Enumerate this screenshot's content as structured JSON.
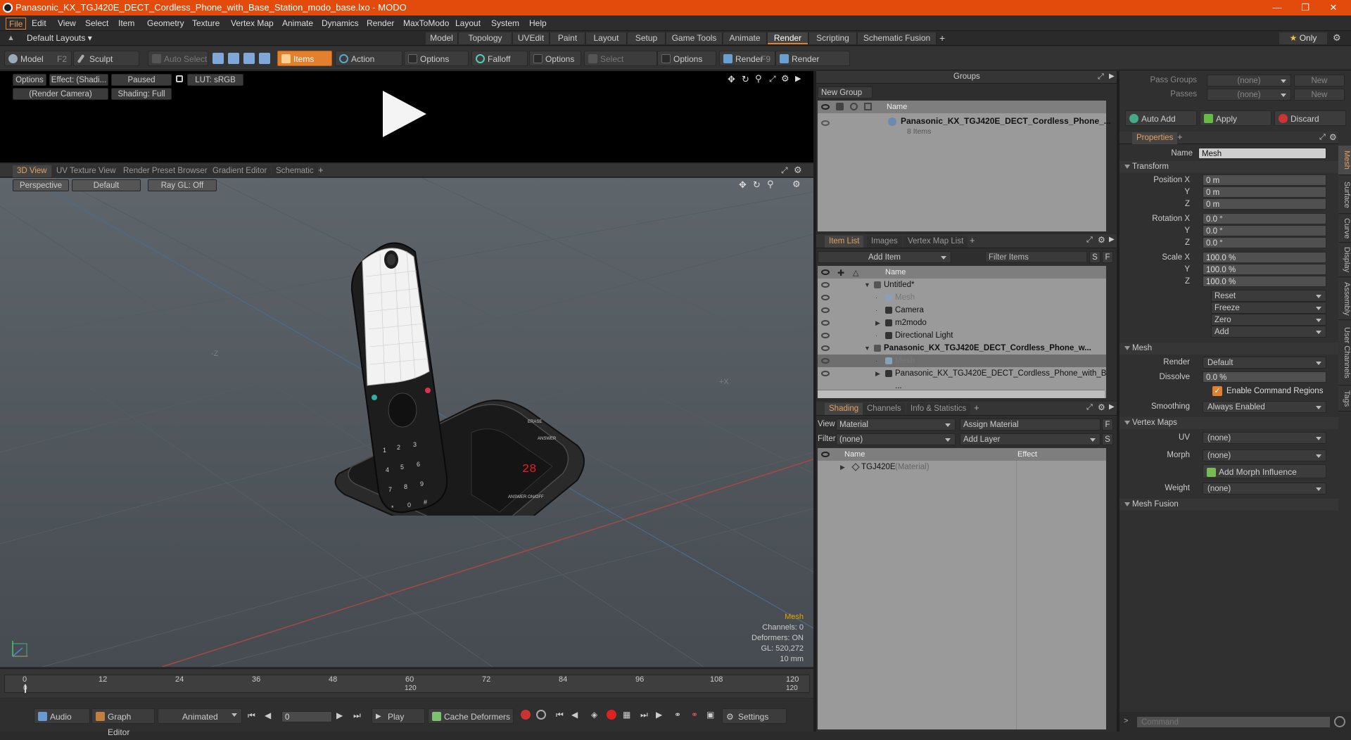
{
  "window": {
    "title": "Panasonic_KX_TGJ420E_DECT_Cordless_Phone_with_Base_Station_modo_base.lxo - MODO"
  },
  "menu": [
    "File",
    "Edit",
    "View",
    "Select",
    "Item",
    "Geometry",
    "Texture",
    "Vertex Map",
    "Animate",
    "Dynamics",
    "Render",
    "MaxToModo",
    "Layout",
    "System",
    "Help"
  ],
  "layout": {
    "default_layouts": "Default Layouts",
    "tabs": [
      "Model",
      "Topology",
      "UVEdit",
      "Paint",
      "Layout",
      "Setup",
      "Game Tools",
      "Animate",
      "Render",
      "Scripting",
      "Schematic Fusion"
    ],
    "active_tab": "Render",
    "only_label": "Only"
  },
  "toolbar": {
    "model": "Model",
    "model_key": "F2",
    "sculpt": "Sculpt",
    "auto_select": "Auto Select",
    "items": "Items",
    "action_center": "Action Center",
    "options1": "Options",
    "falloff": "Falloff",
    "options2": "Options",
    "select_through": "Select Through",
    "options3": "Options",
    "render": "Render",
    "render_key": "F9",
    "render_window": "Render Window"
  },
  "render_view": {
    "options": "Options",
    "effect": "Effect: (Shadi...",
    "paused": "Paused",
    "lut": "LUT: sRGB",
    "camera": "(Render Camera)",
    "shading": "Shading: Full"
  },
  "viewport": {
    "tabs": [
      "3D View",
      "UV Texture View",
      "Render Preset Browser",
      "Gradient Editor",
      "Schematic"
    ],
    "perspective": "Perspective",
    "default": "Default",
    "raygl": "Ray GL: Off",
    "axis_z": "-Z",
    "axis_x": "+X",
    "info": {
      "title": "Mesh",
      "channels": "Channels: 0",
      "deformers": "Deformers: ON",
      "gl": "GL: 520,272",
      "scale": "10 mm"
    }
  },
  "timeline": {
    "ticks": [
      "0",
      "12",
      "24",
      "36",
      "48",
      "60",
      "72",
      "84",
      "96",
      "108",
      "120"
    ],
    "bottom_ticks": [
      "0",
      "120",
      "120"
    ]
  },
  "transport": {
    "audio": "Audio",
    "graph_editor": "Graph Editor",
    "animated": "Animated",
    "frame": "0",
    "play": "Play",
    "cache_deformers": "Cache Deformers",
    "settings": "Settings"
  },
  "groups": {
    "title": "Groups",
    "new_group": "New Group",
    "col_name": "Name",
    "item_name": "Panasonic_KX_TGJ420E_DECT_Cordless_Phone_...",
    "item_count": "8 Items"
  },
  "itemlist": {
    "tabs": [
      "Item List",
      "Images",
      "Vertex Map List"
    ],
    "add_item": "Add Item",
    "filter_items": "Filter Items",
    "col_name": "Name",
    "rows": [
      {
        "name": "Untitled*",
        "indent": 0,
        "bold": false,
        "dim": false
      },
      {
        "name": "Mesh",
        "indent": 1,
        "bold": false,
        "dim": true
      },
      {
        "name": "Camera",
        "indent": 1,
        "bold": false,
        "dim": false
      },
      {
        "name": "m2modo",
        "indent": 1,
        "bold": false,
        "dim": false
      },
      {
        "name": "Directional Light",
        "indent": 1,
        "bold": false,
        "dim": false
      },
      {
        "name": "Panasonic_KX_TGJ420E_DECT_Cordless_Phone_w...",
        "indent": 0,
        "bold": true,
        "dim": false
      },
      {
        "name": "Mesh",
        "indent": 1,
        "bold": false,
        "dim": true
      },
      {
        "name": "Panasonic_KX_TGJ420E_DECT_Cordless_Phone_with_B ...",
        "indent": 1,
        "bold": false,
        "dim": false
      }
    ]
  },
  "shading": {
    "tabs": [
      "Shading",
      "Channels",
      "Info & Statistics"
    ],
    "view_label": "View",
    "view_value": "Material",
    "assign_material": "Assign Material",
    "filter_label": "Filter",
    "filter_value": "(none)",
    "add_layer": "Add Layer",
    "col_name": "Name",
    "col_effect": "Effect",
    "row_name": "TGJ420E",
    "row_type": "(Material)"
  },
  "properties": {
    "pass_groups_label": "Pass Groups",
    "pass_groups_value": "(none)",
    "passes_label": "Passes",
    "passes_value": "(none)",
    "new": "New",
    "auto_add": "Auto Add",
    "apply": "Apply",
    "discard": "Discard",
    "tab": "Properties",
    "name_label": "Name",
    "name_value": "Mesh",
    "transform": "Transform",
    "position_label": "Position X",
    "pos": [
      "0 m",
      "0 m",
      "0 m"
    ],
    "rotation_label": "Rotation X",
    "rot": [
      "0.0 °",
      "0.0 °",
      "0.0 °"
    ],
    "scale_label": "Scale X",
    "scl": [
      "100.0 %",
      "100.0 %",
      "100.0 %"
    ],
    "y": "Y",
    "z": "Z",
    "reset": "Reset",
    "freeze": "Freeze",
    "zero": "Zero",
    "add": "Add",
    "mesh": "Mesh",
    "render_label": "Render",
    "render_value": "Default",
    "dissolve_label": "Dissolve",
    "dissolve_value": "0.0 %",
    "enable_cmd": "Enable Command Regions",
    "smoothing_label": "Smoothing",
    "smoothing_value": "Always Enabled",
    "vertex_maps": "Vertex Maps",
    "uv_label": "UV",
    "uv_value": "(none)",
    "morph_label": "Morph",
    "morph_value": "(none)",
    "add_morph": "Add Morph Influence",
    "weight_label": "Weight",
    "weight_value": "(none)",
    "mesh_fusion": "Mesh Fusion",
    "vtabs": [
      "Mesh",
      "Surface",
      "Curve",
      "Display",
      "Assembly",
      "User Channels",
      "Tags"
    ],
    "command_placeholder": "Command"
  },
  "phone_display": "28"
}
